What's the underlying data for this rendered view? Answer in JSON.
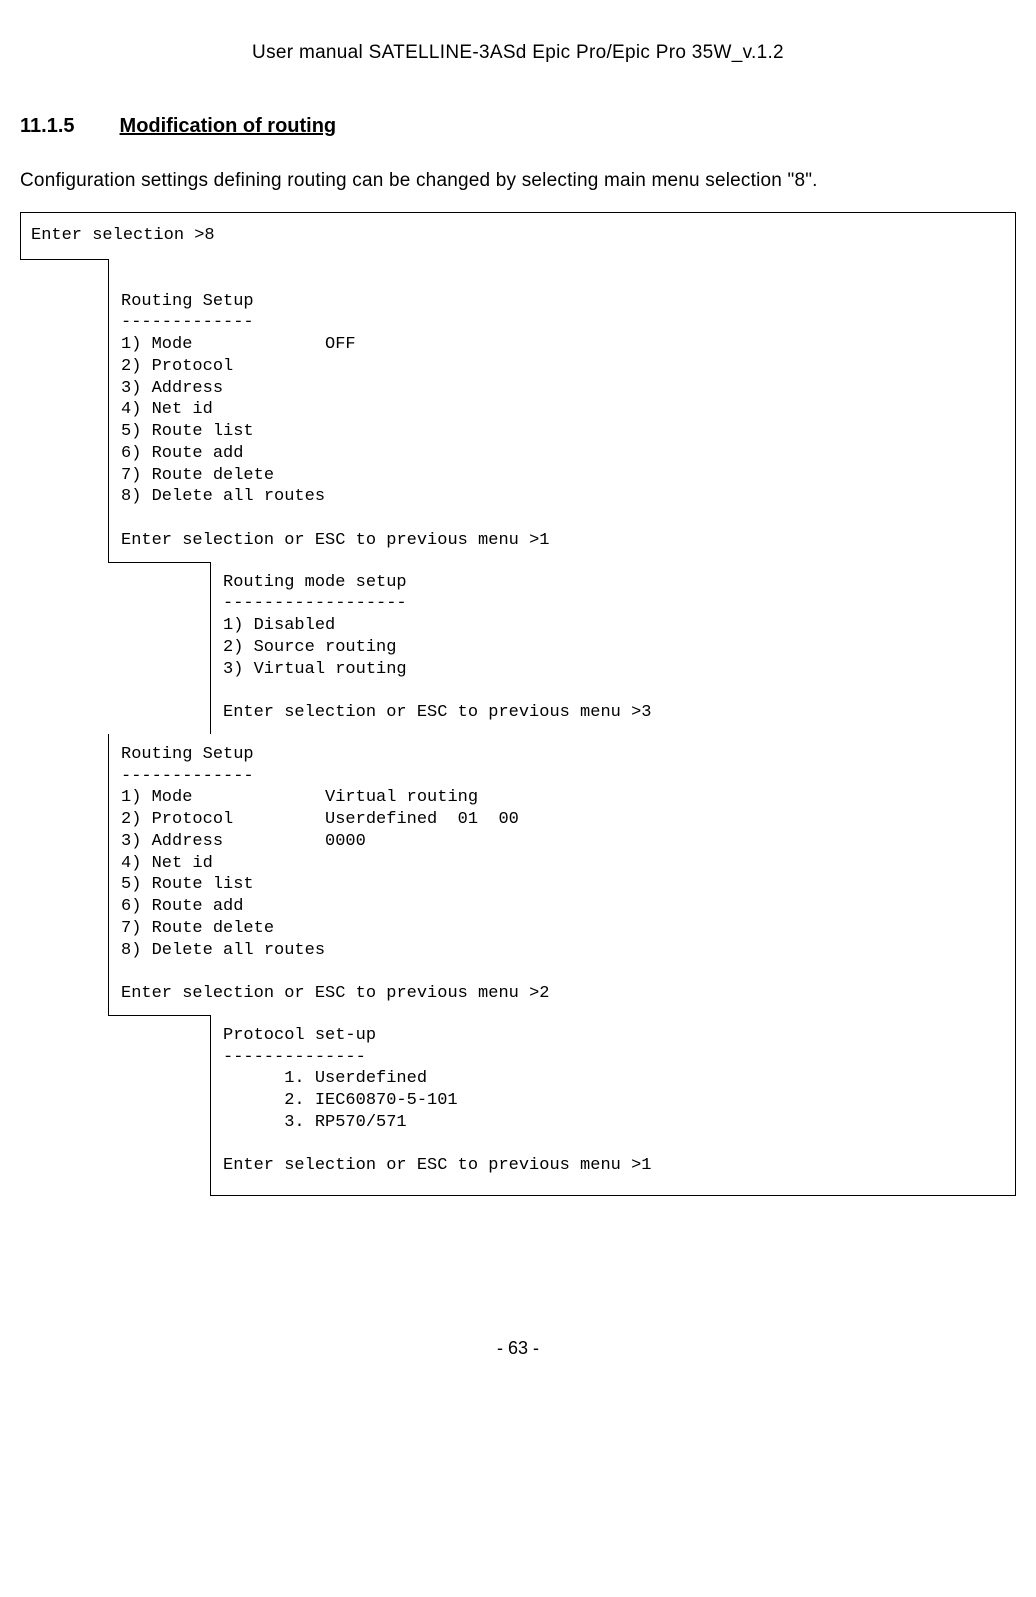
{
  "header": "User manual SATELLINE-3ASd Epic Pro/Epic Pro 35W_v.1.2",
  "section": {
    "number": "11.1.5",
    "title": "Modification of routing"
  },
  "intro": "Configuration settings defining routing can be changed by selecting main menu selection \"8\".",
  "terminal": {
    "b0": "Enter selection >8",
    "b1": "\nRouting Setup\n-------------\n1) Mode             OFF\n2) Protocol\n3) Address\n4) Net id\n5) Route list\n6) Route add\n7) Route delete\n8) Delete all routes\n\nEnter selection or ESC to previous menu >1",
    "b2": "Routing mode setup\n------------------\n1) Disabled\n2) Source routing\n3) Virtual routing\n\nEnter selection or ESC to previous menu >3",
    "b3": "Routing Setup\n-------------\n1) Mode             Virtual routing\n2) Protocol         Userdefined  01  00\n3) Address          0000\n4) Net id\n5) Route list\n6) Route add\n7) Route delete\n8) Delete all routes\n\nEnter selection or ESC to previous menu >2",
    "b4": "Protocol set-up\n--------------\n      1. Userdefined\n      2. IEC60870-5-101\n      3. RP570/571\n\nEnter selection or ESC to previous menu >1"
  },
  "pageNumber": "- 63 -"
}
